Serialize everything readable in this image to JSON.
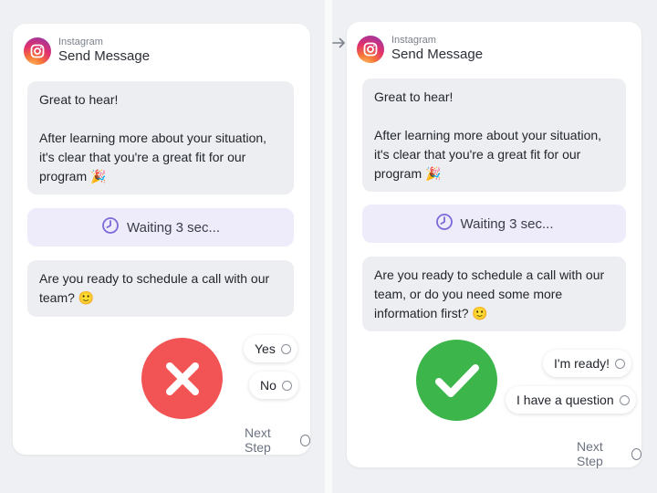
{
  "colors": {
    "reject": "#f25455",
    "accept": "#3cb54a",
    "wait_bg": "#eeebfb",
    "clock": "#7b6ad9"
  },
  "left": {
    "header": {
      "platform": "Instagram",
      "title": "Send Message",
      "icon": "instagram-icon"
    },
    "message1": {
      "line1": "Great to hear!",
      "line2": "After learning more about your situation, it's clear that you're a great fit for our program",
      "emoji": "🎉"
    },
    "wait": {
      "label": "Waiting 3 sec...",
      "icon": "clock-icon"
    },
    "message2": {
      "text": "Are you ready to schedule a call with our team?",
      "emoji": "🙂"
    },
    "options": [
      "Yes",
      "No"
    ],
    "next": "Next Step",
    "verdict_icon": "x-icon"
  },
  "right": {
    "header": {
      "platform": "Instagram",
      "title": "Send Message",
      "icon": "instagram-icon"
    },
    "message1": {
      "line1": "Great to hear!",
      "line2": "After learning more about your situation, it's clear that you're a great fit for our program",
      "emoji": "🎉"
    },
    "wait": {
      "label": "Waiting 3 sec...",
      "icon": "clock-icon"
    },
    "message2": {
      "text": "Are you ready to schedule a call with our team, or do you need some more information first?",
      "emoji": "🙂"
    },
    "options": [
      "I'm ready!",
      "I have a question"
    ],
    "next": "Next Step",
    "verdict_icon": "check-icon"
  }
}
